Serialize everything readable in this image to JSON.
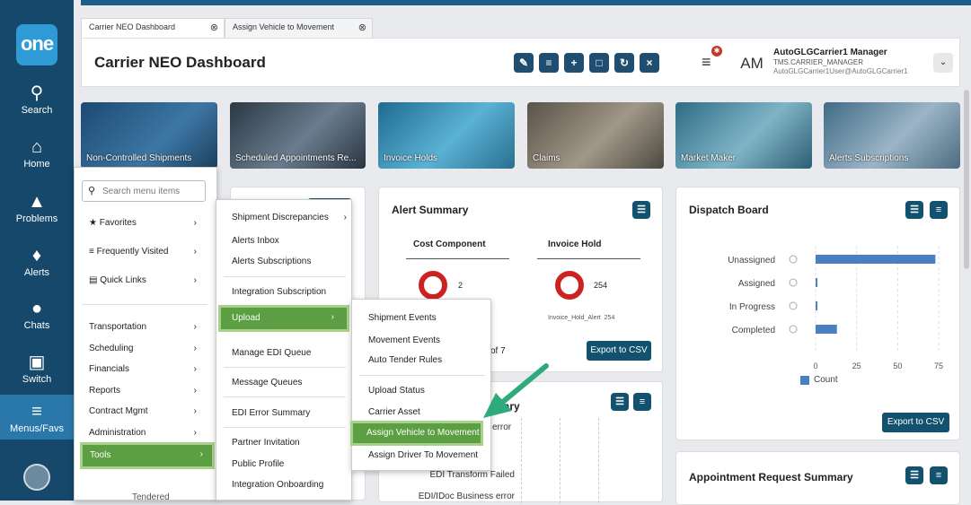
{
  "nav": {
    "logo": "one",
    "items": [
      {
        "label": "Search",
        "icon": "search-icon",
        "glyph": "⌕"
      },
      {
        "label": "Home",
        "icon": "home-icon",
        "glyph": "⌂"
      },
      {
        "label": "Problems",
        "icon": "warning-icon",
        "glyph": "▲"
      },
      {
        "label": "Alerts",
        "icon": "bell-icon",
        "glyph": "♪"
      },
      {
        "label": "Chats",
        "icon": "chat-icon",
        "glyph": "●"
      },
      {
        "label": "Switch",
        "icon": "switch-icon",
        "glyph": "▣"
      },
      {
        "label": "Menus/Favs",
        "icon": "menu-icon",
        "glyph": "≡"
      }
    ]
  },
  "tabs": [
    {
      "label": "Carrier NEO Dashboard"
    },
    {
      "label": "Assign Vehicle to Movement"
    }
  ],
  "header": {
    "title": "Carrier NEO Dashboard",
    "avatar": "AM",
    "user_name": "AutoGLGCarrier1 Manager",
    "user_role": "TMS.CARRIER_MANAGER",
    "user_email": "AutoGLGCarrier1User@AutoGLGCarrier1"
  },
  "tiles": [
    {
      "label": "Non-Controlled Shipments",
      "color": "#2b5a80"
    },
    {
      "label": "Scheduled Appointments Re...",
      "color": "#3c4e5e"
    },
    {
      "label": "Invoice Holds",
      "color": "#2f7fa3"
    },
    {
      "label": "Claims",
      "color": "#6b6a63"
    },
    {
      "label": "Market Maker",
      "color": "#3f7f99"
    },
    {
      "label": "Alerts Subscriptions",
      "color": "#5c7e93"
    }
  ],
  "menu1": {
    "search_placeholder": "Search menu items",
    "top": [
      "Favorites",
      "Frequently Visited",
      "Quick Links"
    ],
    "items": [
      "Transportation",
      "Scheduling",
      "Financials",
      "Reports",
      "Contract Mgmt",
      "Administration",
      "Tools"
    ],
    "partial": "Tendered"
  },
  "menu2": {
    "items": [
      "Shipment Discrepancies",
      "Alerts Inbox",
      "Alerts Subscriptions",
      "Integration Subscription",
      "Upload",
      "Manage EDI Queue",
      "Message Queues",
      "EDI Error Summary",
      "Partner Invitation",
      "Public Profile",
      "Integration Onboarding"
    ]
  },
  "menu3": {
    "items": [
      "Shipment Events",
      "Movement Events",
      "Auto Tender Rules",
      "Upload Status",
      "Carrier Asset",
      "Assign Vehicle to Movement",
      "Assign Driver To Movement"
    ]
  },
  "alert_summary": {
    "title": "Alert Summary",
    "col1": "Cost Component",
    "col2": "Invoice Hold",
    "val1": "2",
    "val2": "254",
    "legend": "Invoice_Hold_Alert",
    "legend_val": "254",
    "pager": "of 7",
    "export": "Export to CSV"
  },
  "edi_panel": {
    "title_partial": "mary",
    "rows": [
      "error",
      "EDI Transform Failed",
      "EDI/IDoc Business error"
    ]
  },
  "dispatch": {
    "title": "Dispatch Board",
    "export": "Export to CSV",
    "legend": "Count"
  },
  "appointment": {
    "title": "Appointment Request Summary"
  },
  "chart_data": {
    "type": "bar",
    "orientation": "horizontal",
    "categories": [
      "Unassigned",
      "Assigned",
      "In Progress",
      "Completed"
    ],
    "series": [
      {
        "name": "Count",
        "values": [
          73,
          1,
          1,
          13
        ]
      }
    ],
    "xlim": [
      0,
      75
    ],
    "ticks": [
      "0",
      "25",
      "50",
      "75"
    ],
    "bar_color": "#4a80c0",
    "grid": true
  }
}
